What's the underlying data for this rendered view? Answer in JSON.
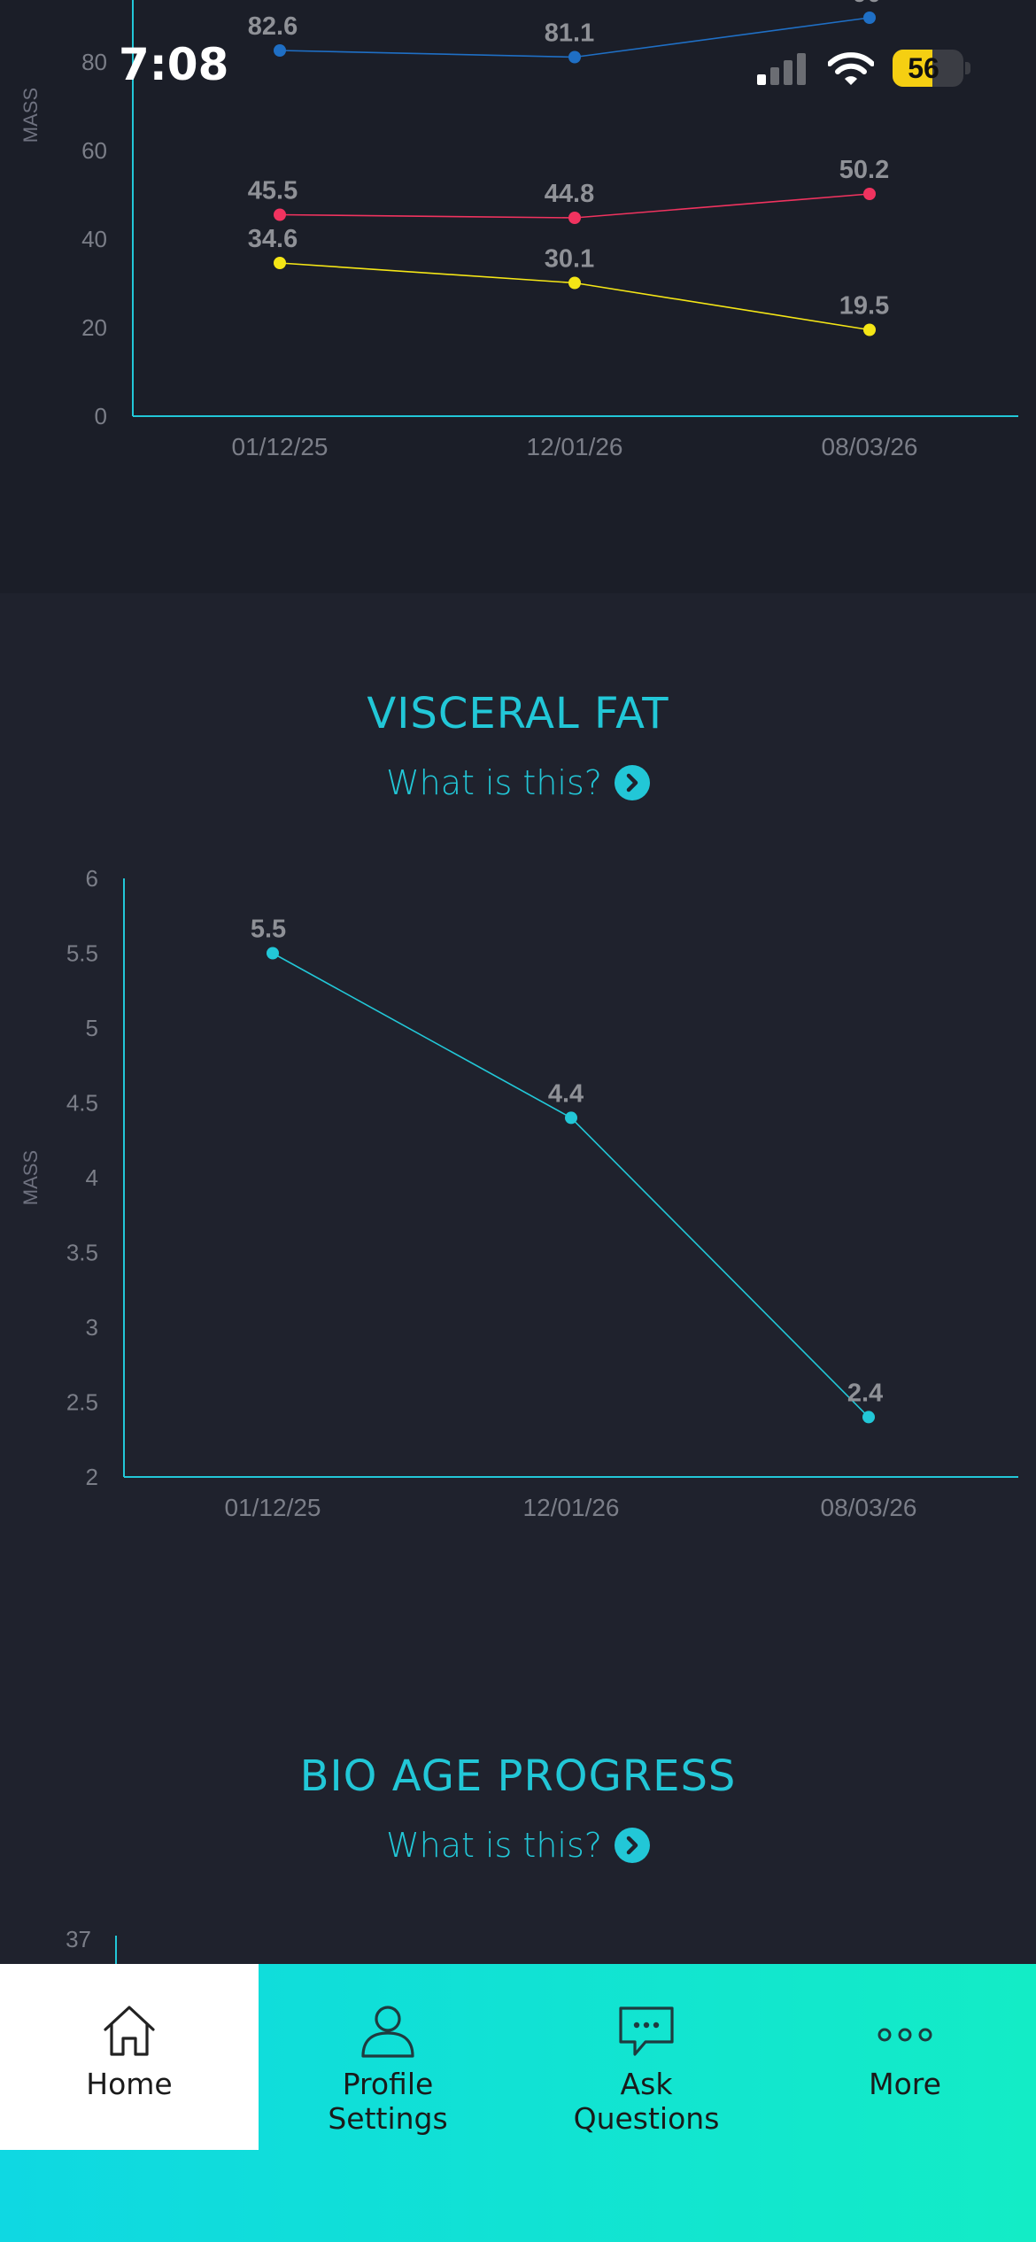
{
  "status_bar": {
    "time": "7:08",
    "battery": "56",
    "battery_level": 0.56
  },
  "sections": {
    "visceral_fat": {
      "title": "VISCERAL FAT",
      "link_label": "What is this?"
    },
    "bio_age": {
      "title": "BIO AGE PROGRESS",
      "link_label": "What is this?"
    }
  },
  "chart_data": [
    {
      "type": "line",
      "title": "",
      "xlabel": "",
      "ylabel": "MASS",
      "categories": [
        "01/12/25",
        "12/01/26",
        "08/03/26"
      ],
      "y_ticks": [
        0,
        20,
        40,
        60,
        80
      ],
      "ylim": [
        0,
        100
      ],
      "grid": false,
      "series": [
        {
          "values": [
            82.6,
            81.1,
            90
          ],
          "color": "#1f6fc5"
        },
        {
          "values": [
            45.5,
            44.8,
            50.2
          ],
          "color": "#f0335f"
        },
        {
          "values": [
            34.6,
            30.1,
            19.5
          ],
          "color": "#f5e616"
        }
      ]
    },
    {
      "type": "line",
      "title": "VISCERAL FAT",
      "xlabel": "",
      "ylabel": "MASS",
      "categories": [
        "01/12/25",
        "12/01/26",
        "08/03/26"
      ],
      "y_ticks": [
        "2",
        "2.5",
        "3",
        "3.5",
        "4",
        "4.5",
        "5",
        "5.5",
        "6"
      ],
      "ylim": [
        2,
        6
      ],
      "grid": false,
      "series": [
        {
          "values": [
            5.5,
            4.4,
            2.4
          ],
          "color": "#22c7d7"
        }
      ]
    },
    {
      "type": "line",
      "title": "BIO AGE PROGRESS",
      "xlabel": "",
      "ylabel": "",
      "y_ticks": [
        "37"
      ],
      "series": []
    }
  ],
  "tabbar": {
    "items": [
      {
        "label": "Home",
        "icon": "home-icon",
        "active": true
      },
      {
        "label": "Profile\nSettings",
        "icon": "person-icon",
        "active": false
      },
      {
        "label": "Ask\nQuestions",
        "icon": "chat-bubble-icon",
        "active": false
      },
      {
        "label": "More",
        "icon": "more-dots-icon",
        "active": false
      }
    ]
  },
  "colors": {
    "accent": "#22c7d7",
    "background": "#1f222d",
    "axis_text": "#7b7e88",
    "value_label": "#8f9197"
  }
}
